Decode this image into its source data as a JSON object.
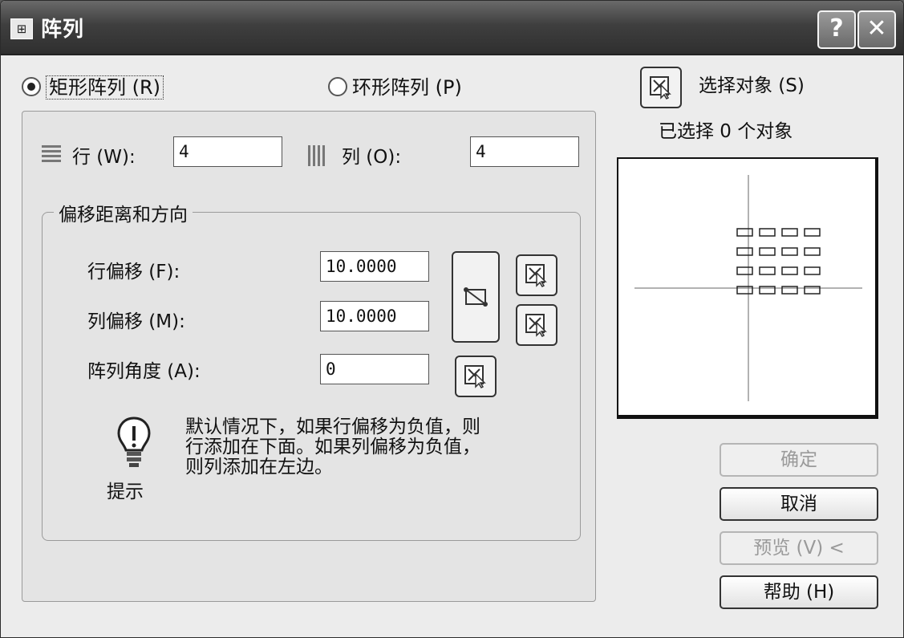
{
  "window": {
    "title": "阵列",
    "icon_glyph": "⊞",
    "help_glyph": "?",
    "close_glyph": "✕"
  },
  "mode": {
    "rect_label": "矩形阵列 (R)",
    "polar_label": "环形阵列 (P)",
    "selected": "rect"
  },
  "select": {
    "label": "选择对象 (S)",
    "status": "已选择 0 个对象"
  },
  "grid": {
    "rows_label": "行 (W):",
    "rows_value": "4",
    "cols_label": "列 (O):",
    "cols_value": "4"
  },
  "offset": {
    "group_title": "偏移距离和方向",
    "row_offset_label": "行偏移 (F):",
    "row_offset_value": "10.0000",
    "col_offset_label": "列偏移 (M):",
    "col_offset_value": "10.0000",
    "angle_label": "阵列角度 (A):",
    "angle_value": "0"
  },
  "tip": {
    "label": "提示",
    "line1": "默认情况下，如果行偏移为负值，则",
    "line2": "行添加在下面。如果列偏移为负值，",
    "line3": "则列添加在左边。"
  },
  "buttons": {
    "ok": "确定",
    "cancel": "取消",
    "preview": "预览 (V) <",
    "help": "帮助 (H)"
  },
  "preview_grid": {
    "rows": 4,
    "cols": 4
  },
  "icons": [
    "array-icon",
    "help-icon",
    "close-icon",
    "select-objects-icon",
    "rows-icon",
    "columns-icon",
    "pick-point-icon",
    "pick-both-offsets-icon",
    "lightbulb-icon"
  ]
}
